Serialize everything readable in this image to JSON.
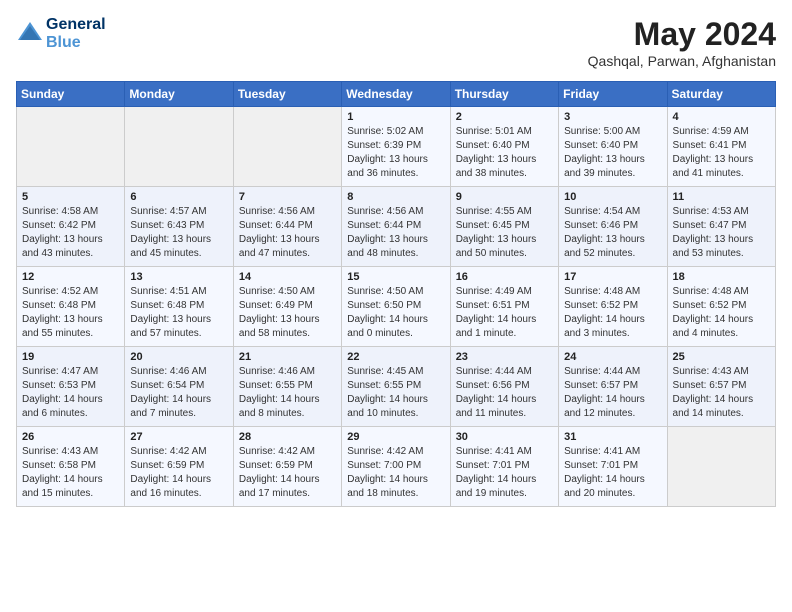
{
  "header": {
    "logo_line1": "General",
    "logo_line2": "Blue",
    "month_year": "May 2024",
    "location": "Qashqal, Parwan, Afghanistan"
  },
  "weekdays": [
    "Sunday",
    "Monday",
    "Tuesday",
    "Wednesday",
    "Thursday",
    "Friday",
    "Saturday"
  ],
  "weeks": [
    [
      {
        "day": "",
        "sunrise": "",
        "sunset": "",
        "daylight": ""
      },
      {
        "day": "",
        "sunrise": "",
        "sunset": "",
        "daylight": ""
      },
      {
        "day": "",
        "sunrise": "",
        "sunset": "",
        "daylight": ""
      },
      {
        "day": "1",
        "sunrise": "Sunrise: 5:02 AM",
        "sunset": "Sunset: 6:39 PM",
        "daylight": "Daylight: 13 hours and 36 minutes."
      },
      {
        "day": "2",
        "sunrise": "Sunrise: 5:01 AM",
        "sunset": "Sunset: 6:40 PM",
        "daylight": "Daylight: 13 hours and 38 minutes."
      },
      {
        "day": "3",
        "sunrise": "Sunrise: 5:00 AM",
        "sunset": "Sunset: 6:40 PM",
        "daylight": "Daylight: 13 hours and 39 minutes."
      },
      {
        "day": "4",
        "sunrise": "Sunrise: 4:59 AM",
        "sunset": "Sunset: 6:41 PM",
        "daylight": "Daylight: 13 hours and 41 minutes."
      }
    ],
    [
      {
        "day": "5",
        "sunrise": "Sunrise: 4:58 AM",
        "sunset": "Sunset: 6:42 PM",
        "daylight": "Daylight: 13 hours and 43 minutes."
      },
      {
        "day": "6",
        "sunrise": "Sunrise: 4:57 AM",
        "sunset": "Sunset: 6:43 PM",
        "daylight": "Daylight: 13 hours and 45 minutes."
      },
      {
        "day": "7",
        "sunrise": "Sunrise: 4:56 AM",
        "sunset": "Sunset: 6:44 PM",
        "daylight": "Daylight: 13 hours and 47 minutes."
      },
      {
        "day": "8",
        "sunrise": "Sunrise: 4:56 AM",
        "sunset": "Sunset: 6:44 PM",
        "daylight": "Daylight: 13 hours and 48 minutes."
      },
      {
        "day": "9",
        "sunrise": "Sunrise: 4:55 AM",
        "sunset": "Sunset: 6:45 PM",
        "daylight": "Daylight: 13 hours and 50 minutes."
      },
      {
        "day": "10",
        "sunrise": "Sunrise: 4:54 AM",
        "sunset": "Sunset: 6:46 PM",
        "daylight": "Daylight: 13 hours and 52 minutes."
      },
      {
        "day": "11",
        "sunrise": "Sunrise: 4:53 AM",
        "sunset": "Sunset: 6:47 PM",
        "daylight": "Daylight: 13 hours and 53 minutes."
      }
    ],
    [
      {
        "day": "12",
        "sunrise": "Sunrise: 4:52 AM",
        "sunset": "Sunset: 6:48 PM",
        "daylight": "Daylight: 13 hours and 55 minutes."
      },
      {
        "day": "13",
        "sunrise": "Sunrise: 4:51 AM",
        "sunset": "Sunset: 6:48 PM",
        "daylight": "Daylight: 13 hours and 57 minutes."
      },
      {
        "day": "14",
        "sunrise": "Sunrise: 4:50 AM",
        "sunset": "Sunset: 6:49 PM",
        "daylight": "Daylight: 13 hours and 58 minutes."
      },
      {
        "day": "15",
        "sunrise": "Sunrise: 4:50 AM",
        "sunset": "Sunset: 6:50 PM",
        "daylight": "Daylight: 14 hours and 0 minutes."
      },
      {
        "day": "16",
        "sunrise": "Sunrise: 4:49 AM",
        "sunset": "Sunset: 6:51 PM",
        "daylight": "Daylight: 14 hours and 1 minute."
      },
      {
        "day": "17",
        "sunrise": "Sunrise: 4:48 AM",
        "sunset": "Sunset: 6:52 PM",
        "daylight": "Daylight: 14 hours and 3 minutes."
      },
      {
        "day": "18",
        "sunrise": "Sunrise: 4:48 AM",
        "sunset": "Sunset: 6:52 PM",
        "daylight": "Daylight: 14 hours and 4 minutes."
      }
    ],
    [
      {
        "day": "19",
        "sunrise": "Sunrise: 4:47 AM",
        "sunset": "Sunset: 6:53 PM",
        "daylight": "Daylight: 14 hours and 6 minutes."
      },
      {
        "day": "20",
        "sunrise": "Sunrise: 4:46 AM",
        "sunset": "Sunset: 6:54 PM",
        "daylight": "Daylight: 14 hours and 7 minutes."
      },
      {
        "day": "21",
        "sunrise": "Sunrise: 4:46 AM",
        "sunset": "Sunset: 6:55 PM",
        "daylight": "Daylight: 14 hours and 8 minutes."
      },
      {
        "day": "22",
        "sunrise": "Sunrise: 4:45 AM",
        "sunset": "Sunset: 6:55 PM",
        "daylight": "Daylight: 14 hours and 10 minutes."
      },
      {
        "day": "23",
        "sunrise": "Sunrise: 4:44 AM",
        "sunset": "Sunset: 6:56 PM",
        "daylight": "Daylight: 14 hours and 11 minutes."
      },
      {
        "day": "24",
        "sunrise": "Sunrise: 4:44 AM",
        "sunset": "Sunset: 6:57 PM",
        "daylight": "Daylight: 14 hours and 12 minutes."
      },
      {
        "day": "25",
        "sunrise": "Sunrise: 4:43 AM",
        "sunset": "Sunset: 6:57 PM",
        "daylight": "Daylight: 14 hours and 14 minutes."
      }
    ],
    [
      {
        "day": "26",
        "sunrise": "Sunrise: 4:43 AM",
        "sunset": "Sunset: 6:58 PM",
        "daylight": "Daylight: 14 hours and 15 minutes."
      },
      {
        "day": "27",
        "sunrise": "Sunrise: 4:42 AM",
        "sunset": "Sunset: 6:59 PM",
        "daylight": "Daylight: 14 hours and 16 minutes."
      },
      {
        "day": "28",
        "sunrise": "Sunrise: 4:42 AM",
        "sunset": "Sunset: 6:59 PM",
        "daylight": "Daylight: 14 hours and 17 minutes."
      },
      {
        "day": "29",
        "sunrise": "Sunrise: 4:42 AM",
        "sunset": "Sunset: 7:00 PM",
        "daylight": "Daylight: 14 hours and 18 minutes."
      },
      {
        "day": "30",
        "sunrise": "Sunrise: 4:41 AM",
        "sunset": "Sunset: 7:01 PM",
        "daylight": "Daylight: 14 hours and 19 minutes."
      },
      {
        "day": "31",
        "sunrise": "Sunrise: 4:41 AM",
        "sunset": "Sunset: 7:01 PM",
        "daylight": "Daylight: 14 hours and 20 minutes."
      },
      {
        "day": "",
        "sunrise": "",
        "sunset": "",
        "daylight": ""
      }
    ]
  ]
}
